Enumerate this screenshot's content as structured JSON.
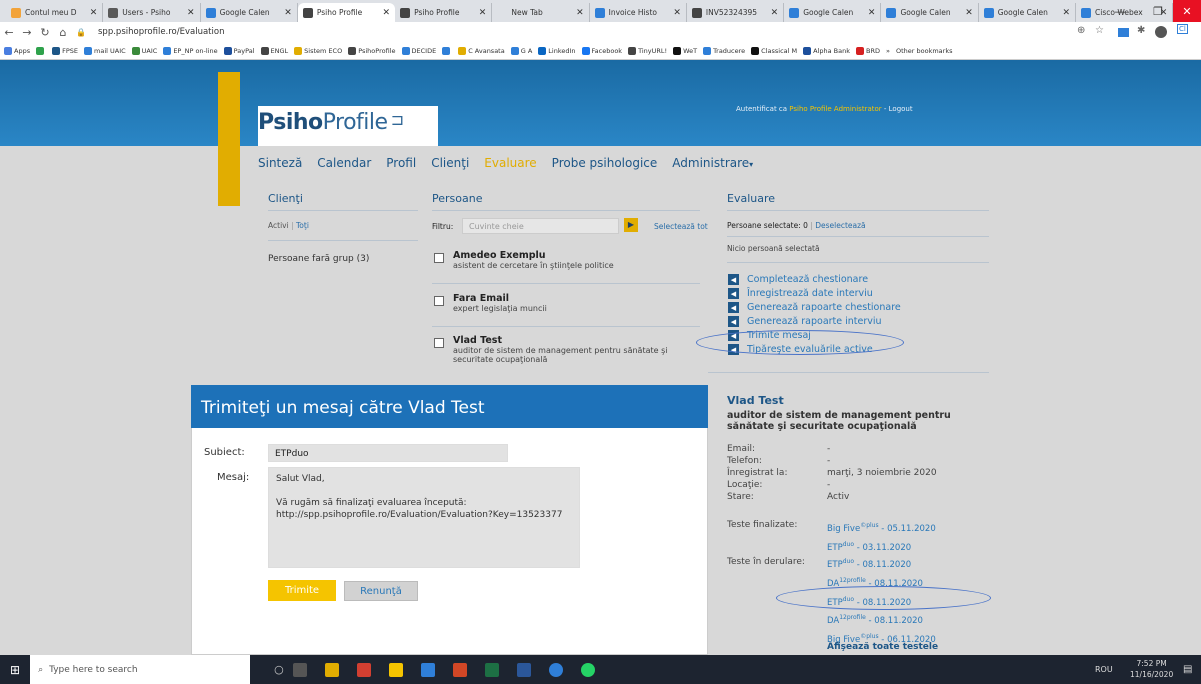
{
  "browser": {
    "tabs": [
      {
        "title": "Contul meu D",
        "color": "#f2a33a"
      },
      {
        "title": "Users - Psiho",
        "color": "#5a5a5a"
      },
      {
        "title": "Google Calen",
        "color": "#2f7fd8"
      },
      {
        "title": "Psiho Profile",
        "color": "#444444",
        "active": true
      },
      {
        "title": "Psiho Profile",
        "color": "#444444"
      },
      {
        "title": "New Tab",
        "color": "#dee1e6"
      },
      {
        "title": "Invoice Histo",
        "color": "#2f7fd8"
      },
      {
        "title": "INV52324395",
        "color": "#444444"
      },
      {
        "title": "Google Calen",
        "color": "#2f7fd8"
      },
      {
        "title": "Google Calen",
        "color": "#2f7fd8"
      },
      {
        "title": "Google Calen",
        "color": "#2f7fd8"
      },
      {
        "title": "Cisco Webex",
        "color": "#2f7fd8"
      }
    ],
    "url": "spp.psihoprofile.ro/Evaluation",
    "bookmarks": [
      {
        "label": "Apps",
        "color": "#4a7ee0"
      },
      {
        "label": "",
        "color": "#2fa24c"
      },
      {
        "label": "FPSE",
        "color": "#1d5687"
      },
      {
        "label": "mail UAIC",
        "color": "#2f7fd8"
      },
      {
        "label": "UAIC",
        "color": "#3a8a3a"
      },
      {
        "label": "EP_NP on-line",
        "color": "#2f7fd8"
      },
      {
        "label": "PayPal",
        "color": "#1d4f9c"
      },
      {
        "label": "ENGL",
        "color": "#444444"
      },
      {
        "label": "Sistem ECO",
        "color": "#e1ad01"
      },
      {
        "label": "PsihoProfile",
        "color": "#444444"
      },
      {
        "label": "DECIDE",
        "color": "#2f7fd8"
      },
      {
        "label": "",
        "color": "#2f7fd8"
      },
      {
        "label": "C Avansata",
        "color": "#e1ad01"
      },
      {
        "label": "G A",
        "color": "#2f7fd8"
      },
      {
        "label": "LinkedIn",
        "color": "#0a66c2"
      },
      {
        "label": "Facebook",
        "color": "#1877f2"
      },
      {
        "label": "TinyURL!",
        "color": "#444444"
      },
      {
        "label": "WeT",
        "color": "#111111"
      },
      {
        "label": "Traducere",
        "color": "#2f7fd8"
      },
      {
        "label": "Classical M",
        "color": "#111111"
      },
      {
        "label": "Alpha Bank",
        "color": "#1d4f9c"
      },
      {
        "label": "BRD",
        "color": "#d62020"
      }
    ],
    "bookmarks_more": "»",
    "bookmarks_other": "Other bookmarks"
  },
  "header": {
    "logo_bold": "Psiho",
    "logo_rest": "Profile",
    "auth_prefix": "Autentificat ca",
    "auth_user": "Psiho Profile Administrator",
    "auth_sep": "-",
    "logout": "Logout"
  },
  "menu": [
    "Sinteză",
    "Calendar",
    "Profil",
    "Clienţi",
    "Evaluare",
    "Probe psihologice",
    "Administrare"
  ],
  "clients": {
    "title": "Clienţi",
    "active": "Activi",
    "all": "Toţi",
    "group": "Persoane fară grup (3)"
  },
  "persons": {
    "title": "Persoane",
    "filter_label": "Filtru:",
    "filter_placeholder": "Cuvinte cheie",
    "select_all": "Selectează tot",
    "list": [
      {
        "name": "Amedeo Exemplu",
        "desc": "asistent de cercetare în ştiinţele politice"
      },
      {
        "name": "Fara Email",
        "desc": "expert legislaţia muncii"
      },
      {
        "name": "Vlad Test",
        "desc": "auditor de sistem de management pentru sănătate şi securitate ocupaţională"
      }
    ]
  },
  "evaluation": {
    "title": "Evaluare",
    "selected": "Persoane selectate: 0",
    "deselect": "Deselectează",
    "none": "Nicio persoană selectată",
    "actions": [
      "Completează chestionare",
      "Înregistrează date interviu",
      "Generează rapoarte chestionare",
      "Generează rapoarte interviu",
      "Trimite mesaj",
      "Tipăreşte evaluările active"
    ]
  },
  "person_detail": {
    "name": "Vlad Test",
    "title": "auditor de sistem de management pentru sănătate şi securitate ocupaţională",
    "fields": [
      {
        "label": "Email:",
        "value": "-"
      },
      {
        "label": "Telefon:",
        "value": "-"
      },
      {
        "label": "Înregistrat la:",
        "value": "marţi, 3 noiembrie 2020"
      },
      {
        "label": "Locaţie:",
        "value": "-"
      },
      {
        "label": "Stare:",
        "value": "Activ"
      }
    ],
    "finished_label": "Teste finalizate:",
    "finished": [
      {
        "base": "Big Five",
        "sup": "©plus",
        "date": " - 05.11.2020"
      },
      {
        "base": "ETP",
        "sup": "duo",
        "date": " - 03.11.2020"
      }
    ],
    "ongoing_label": "Teste în derulare:",
    "ongoing": [
      {
        "base": "ETP",
        "sup": "duo",
        "date": " - 08.11.2020"
      },
      {
        "base": "DA",
        "sup": "12profile",
        "date": " - 08.11.2020"
      },
      {
        "base": "ETP",
        "sup": "duo",
        "date": " - 08.11.2020"
      },
      {
        "base": "DA",
        "sup": "12profile",
        "date": " - 08.11.2020"
      },
      {
        "base": "Big Five",
        "sup": "©plus",
        "date": " - 06.11.2020"
      }
    ],
    "show_all": "Afişează toate testele"
  },
  "modal": {
    "title": "Trimiteţi un mesaj către Vlad Test",
    "subject_label": "Subiect:",
    "subject_value": "ETPduo",
    "message_label": "Mesaj:",
    "message_value": "Salut Vlad,\n\nVă rugăm să finalizaţi evaluarea începută:\nhttp://spp.psihoprofile.ro/Evaluation/Evaluation?Key=13523377",
    "send": "Trimite",
    "cancel": "Renunţă"
  },
  "taskbar": {
    "search": "Type here to search",
    "lang": "ROU",
    "time": "7:52 PM",
    "date": "11/16/2020"
  },
  "colors": {
    "header_blue": "#1d71b8",
    "gold": "#e1ad01",
    "link_blue": "#2a78b8",
    "annotation_blue": "#4a73c8"
  }
}
